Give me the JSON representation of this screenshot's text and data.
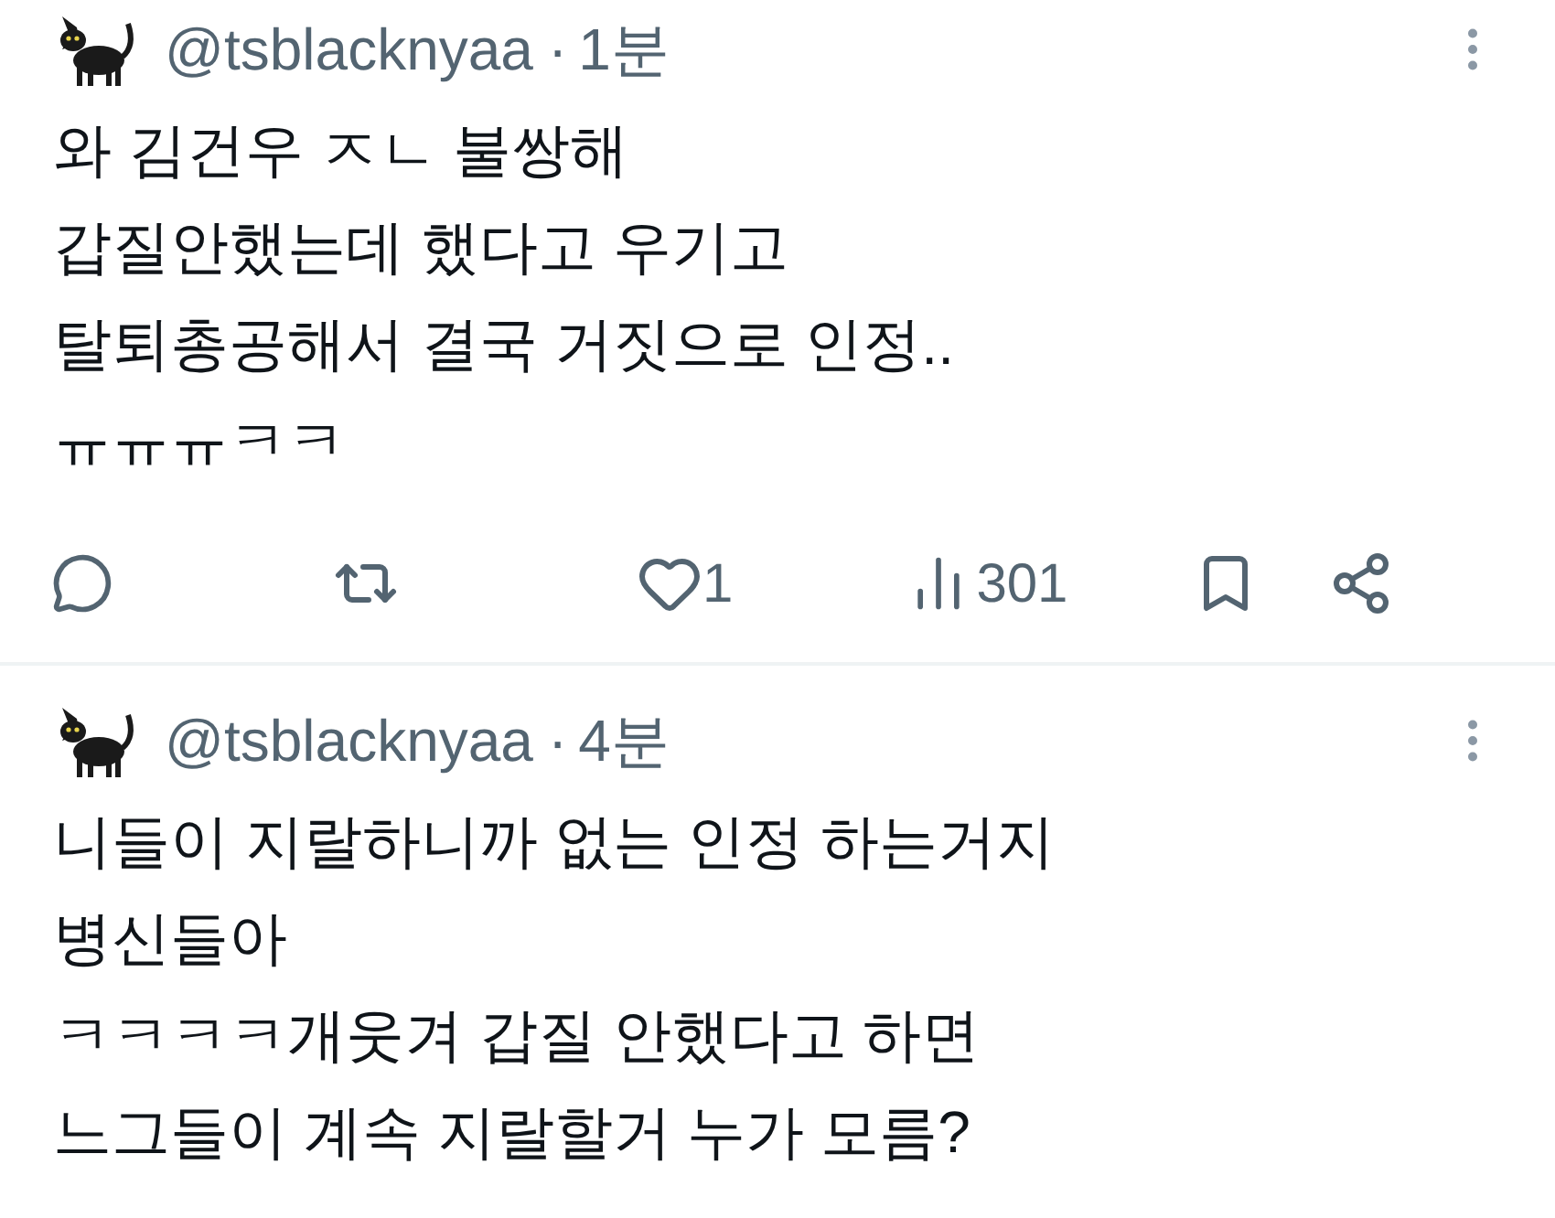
{
  "tweets": [
    {
      "handle": "@tsblacknyaa",
      "separator": "·",
      "time": "1분",
      "lines": [
        "와 김건우 ㅈㄴ 불쌍해",
        "갑질안했는데 했다고 우기고",
        "탈퇴총공해서 결국 거짓으로 인정..",
        "ㅠㅠㅠㅋㅋ"
      ],
      "actions": {
        "likes": "1",
        "views": "301"
      }
    },
    {
      "handle": "@tsblacknyaa",
      "separator": "·",
      "time": "4분",
      "lines": [
        "니들이 지랄하니까 없는 인정 하는거지",
        "병신들아",
        "ㅋㅋㅋㅋ개웃겨 갑질 안했다고 하면",
        "느그들이 계속 지랄할거 누가 모름?"
      ]
    }
  ]
}
